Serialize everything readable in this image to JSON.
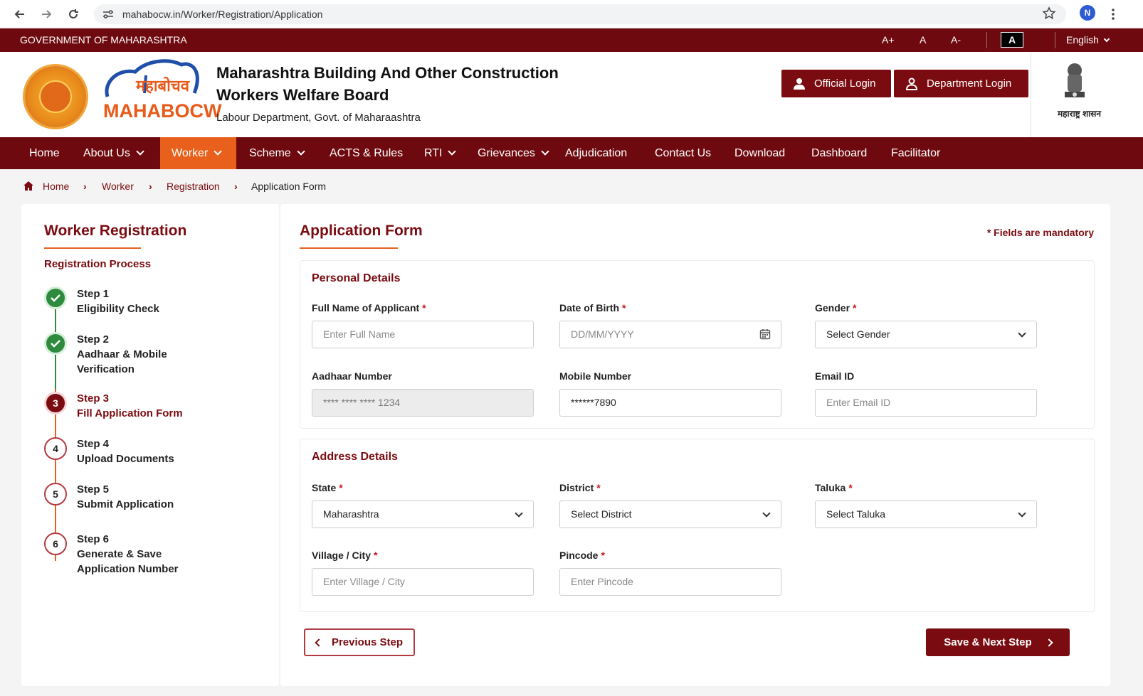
{
  "browser": {
    "url": "mahabocw.in/Worker/Registration/Application",
    "profile_initial": "N"
  },
  "gov_bar": {
    "title": "GOVERNMENT OF MAHARASHTRA",
    "font_increase": "A+",
    "font_normal": "A",
    "font_decrease": "A-",
    "contrast": "A",
    "language": "English"
  },
  "header": {
    "logo_text": "MAHABOCW",
    "logo_devanagari": "महाबोचव",
    "title_line1": "Maharashtra Building And Other Construction",
    "title_line2": "Workers Welfare Board",
    "subtitle": "Labour Department, Govt. of Maharaashtra",
    "official_login": "Official Login",
    "department_login": "Department Login",
    "emblem_caption": "महाराष्ट्र शासन"
  },
  "nav": {
    "items": [
      "Home",
      "About Us",
      "Worker",
      "Scheme",
      "ACTS & Rules",
      "RTI",
      "Grievances",
      "Adjudication",
      "Contact Us",
      "Download",
      "Dashboard",
      "Facilitator"
    ],
    "active": "Worker"
  },
  "breadcrumb": {
    "home": "Home",
    "worker": "Worker",
    "registration": "Registration",
    "current": "Application Form"
  },
  "sidebar": {
    "title": "Worker Registration",
    "subtitle": "Registration Process",
    "steps": [
      {
        "num": "Step 1",
        "label": "Eligibility Check",
        "status": "done"
      },
      {
        "num": "Step 2",
        "label": "Aadhaar & Mobile Verification",
        "status": "done"
      },
      {
        "num": "Step 3",
        "label": "Fill Application Form",
        "status": "current",
        "badge": "3"
      },
      {
        "num": "Step 4",
        "label": "Upload Documents",
        "status": "todo",
        "badge": "4"
      },
      {
        "num": "Step 5",
        "label": "Submit Application",
        "status": "todo",
        "badge": "5"
      },
      {
        "num": "Step 6",
        "label": "Generate & Save Application Number",
        "status": "todo",
        "badge": "6"
      }
    ]
  },
  "form": {
    "title": "Application Form",
    "mandatory_note": "* Fields are mandatory",
    "personal": {
      "title": "Personal Details",
      "full_name": {
        "label": "Full Name of Applicant",
        "placeholder": "Enter Full Name"
      },
      "dob": {
        "label": "Date of Birth",
        "placeholder": "DD/MM/YYYY"
      },
      "gender": {
        "label": "Gender",
        "value": "Select Gender"
      },
      "aadhaar": {
        "label": "Aadhaar Number",
        "value": "**** **** **** 1234"
      },
      "mobile": {
        "label": "Mobile Number",
        "value": "******7890"
      },
      "email": {
        "label": "Email ID",
        "placeholder": "Enter Email ID"
      }
    },
    "address": {
      "title": "Address Details",
      "state": {
        "label": "State",
        "value": "Maharashtra"
      },
      "district": {
        "label": "District",
        "value": "Select District"
      },
      "taluka": {
        "label": "Taluka",
        "value": "Select Taluka"
      },
      "village": {
        "label": "Village / City",
        "placeholder": "Enter Village / City"
      },
      "pincode": {
        "label": "Pincode",
        "placeholder": "Enter Pincode"
      }
    },
    "prev_button": "Previous Step",
    "next_button": "Save & Next Step"
  },
  "colors": {
    "maroon": "#6e0a0f",
    "accent_orange": "#e8601c",
    "success_green": "#2e8b3e"
  }
}
